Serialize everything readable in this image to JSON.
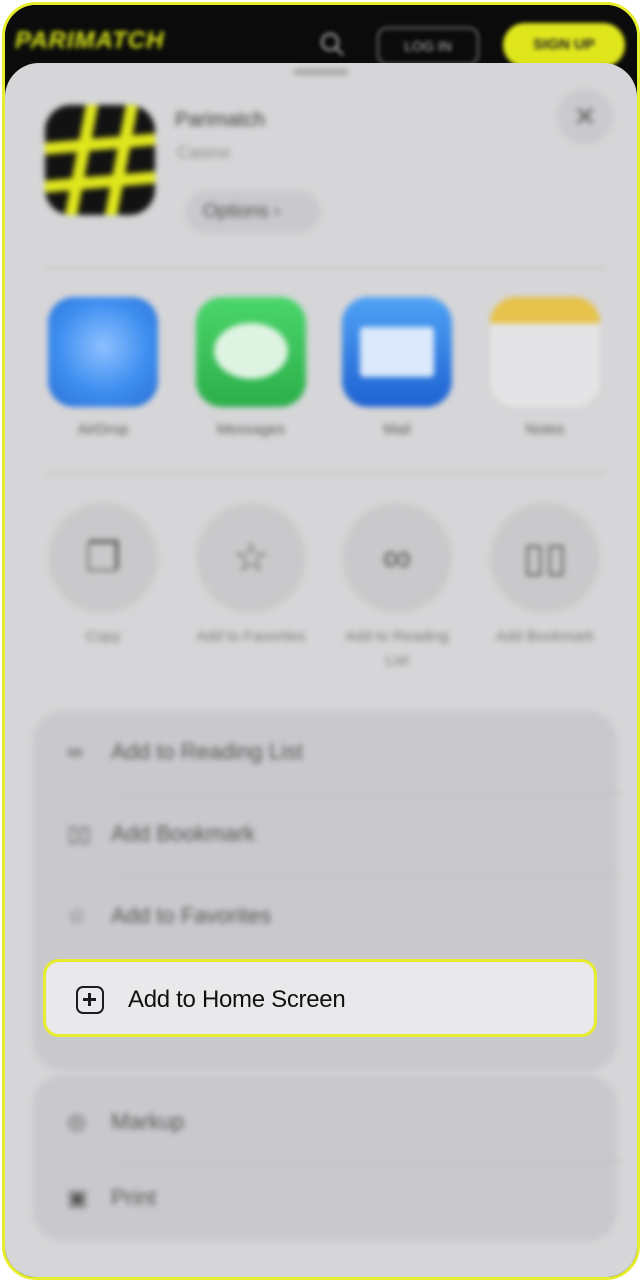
{
  "header": {
    "brand": "PARIMATCH",
    "login_label": "LOG IN",
    "signup_label": "SIGN UP",
    "accent_color": "#dfe61c"
  },
  "sheet": {
    "app_title": "Parimatch",
    "app_subtitle": "Casino",
    "options_label": "Options ›",
    "close_icon": "×",
    "share_apps": [
      {
        "label": "AirDrop",
        "icon": "airdrop-icon"
      },
      {
        "label": "Messages",
        "icon": "messages-icon"
      },
      {
        "label": "Mail",
        "icon": "mail-icon"
      },
      {
        "label": "Notes",
        "icon": "notes-icon"
      }
    ],
    "actions": [
      {
        "label": "Copy",
        "icon": "copy-icon"
      },
      {
        "label": "Add to Favorites",
        "icon": "star-icon"
      },
      {
        "label": "Add to Reading List",
        "icon": "glasses-icon"
      },
      {
        "label": "Add Bookmark",
        "icon": "book-icon"
      }
    ],
    "menu_group1": [
      {
        "label": "Add to Reading List",
        "icon": "glasses-icon"
      },
      {
        "label": "Add Bookmark",
        "icon": "book-icon"
      },
      {
        "label": "Add to Favorites",
        "icon": "star-icon"
      }
    ],
    "highlighted_item": {
      "label": "Add to Home Screen",
      "icon": "plus-square-icon"
    },
    "menu_group2": [
      {
        "label": "Markup",
        "icon": "markup-icon"
      },
      {
        "label": "Print",
        "icon": "print-icon"
      }
    ]
  }
}
